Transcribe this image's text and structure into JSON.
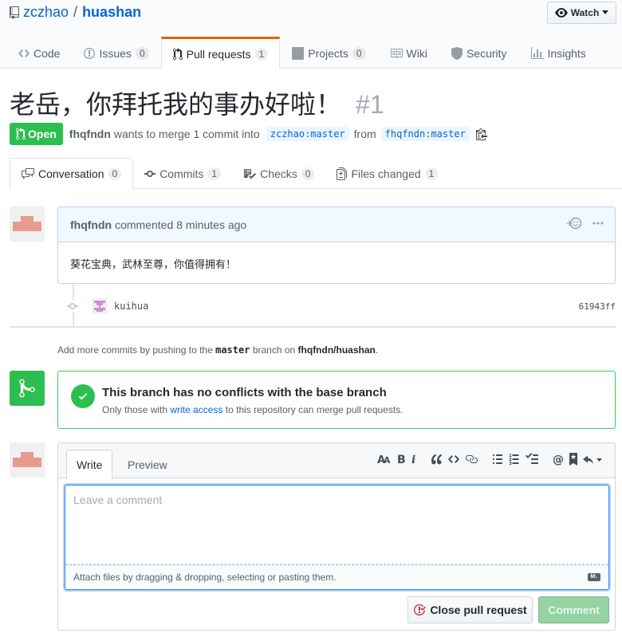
{
  "repo": {
    "owner": "zczhao",
    "separator": "/",
    "name": "huashan"
  },
  "watch": {
    "label": "Watch"
  },
  "reponav": [
    {
      "label": "Code",
      "icon": "code-icon"
    },
    {
      "label": "Issues",
      "count": "0",
      "icon": "issue-icon"
    },
    {
      "label": "Pull requests",
      "count": "1",
      "icon": "pull-request-icon"
    },
    {
      "label": "Projects",
      "count": "0",
      "icon": "project-icon"
    },
    {
      "label": "Wiki",
      "icon": "book-icon"
    },
    {
      "label": "Security",
      "icon": "shield-icon"
    },
    {
      "label": "Insights",
      "icon": "graph-icon"
    }
  ],
  "pr": {
    "title": "老岳，你拜托我的事办好啦！",
    "number": "#1",
    "state": "Open",
    "author": "fhqfndn",
    "wants_text": "wants to merge 1 commit into",
    "base": "zczhao:master",
    "from_text": "from",
    "head": "fhqfndn:master"
  },
  "prtabs": [
    {
      "label": "Conversation",
      "count": "0",
      "icon": "comment-discussion-icon"
    },
    {
      "label": "Commits",
      "count": "1",
      "icon": "git-commit-icon"
    },
    {
      "label": "Checks",
      "count": "0",
      "icon": "checklist-icon"
    },
    {
      "label": "Files changed",
      "count": "1",
      "icon": "diff-icon"
    }
  ],
  "comment": {
    "author": "fhqfndn",
    "action": "commented",
    "time": "8 minutes ago",
    "body": "葵花宝典，武林至尊，你值得拥有！"
  },
  "commit": {
    "message": "kuihua",
    "sha": "61943ff"
  },
  "hint": {
    "prefix": "Add more commits by pushing to the",
    "branch": "master",
    "middle": "branch on",
    "repo": "fhqfndn/huashan",
    "suffix": "."
  },
  "merge": {
    "heading": "This branch has no conflicts with the base branch",
    "prefix": "Only those with",
    "link": "write access",
    "suffix": "to this repository can merge pull requests."
  },
  "editor": {
    "write_tab": "Write",
    "preview_tab": "Preview",
    "placeholder": "Leave a comment",
    "attach_text": "Attach files by dragging & dropping, selecting or pasting them.",
    "close_button": "Close pull request",
    "comment_button": "Comment",
    "markdown_badge": "M↓"
  },
  "colors": {
    "accent": "#0366d6",
    "success": "#2cbe4e",
    "tab_highlight": "#e36209"
  }
}
